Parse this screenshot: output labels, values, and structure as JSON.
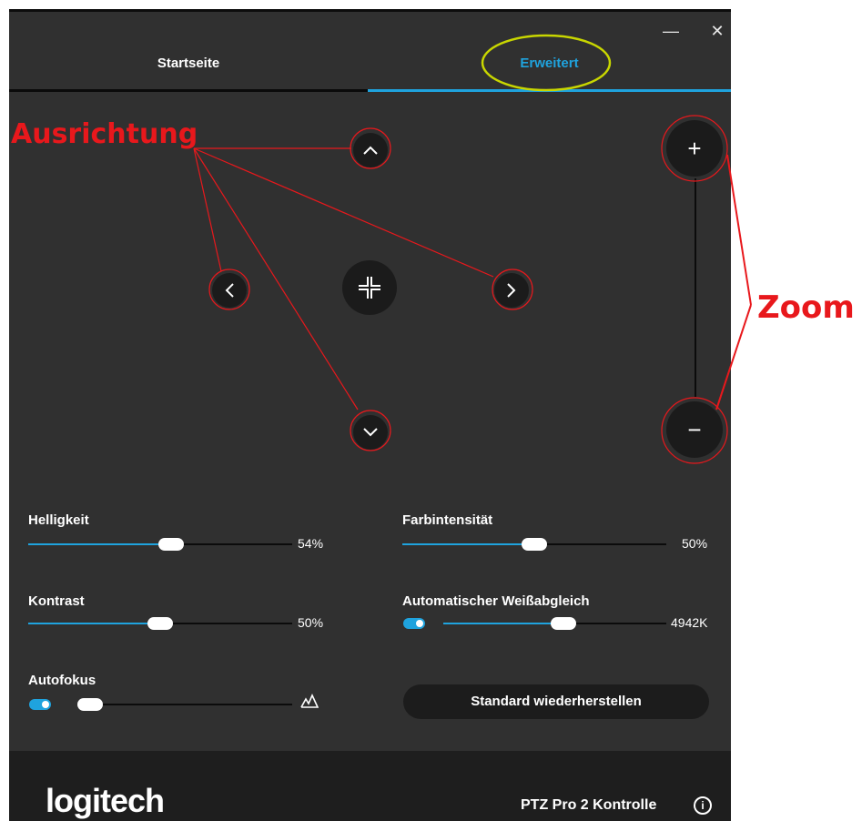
{
  "window": {
    "minimize_icon": "minus-icon",
    "close_icon": "close-icon",
    "minimize_glyph": "—",
    "close_glyph": "✕"
  },
  "tabs": [
    {
      "label": "Startseite",
      "active": false
    },
    {
      "label": "Erweitert",
      "active": true
    }
  ],
  "pan_tilt": {
    "up_icon": "chevron-up-icon",
    "down_icon": "chevron-down-icon",
    "left_icon": "chevron-left-icon",
    "right_icon": "chevron-right-icon",
    "center_icon": "center-crosshair-icon"
  },
  "zoom": {
    "in_glyph": "+",
    "out_glyph": "−"
  },
  "sliders": {
    "brightness": {
      "label": "Helligkeit",
      "value": "54%",
      "level": 0.54
    },
    "saturation": {
      "label": "Farbintensität",
      "value": "50%",
      "level": 0.5
    },
    "contrast": {
      "label": "Kontrast",
      "value": "50%",
      "level": 0.5
    },
    "white_balance": {
      "label": "Automatischer Weißabgleich",
      "value": "4942K",
      "level": 0.54,
      "auto_enabled": true
    },
    "focus": {
      "label": "Autofokus",
      "level": 0.0,
      "auto_enabled": true,
      "end_icon": "focus-mountain-icon"
    }
  },
  "restore_button": {
    "label": "Standard wiederherstellen"
  },
  "footer": {
    "logo_text": "logitech",
    "product_name": "PTZ Pro 2 Kontrolle",
    "info_glyph": "i"
  },
  "annotations": {
    "pan_label": "Ausrichtung",
    "zoom_label": "Zoom",
    "color": "#e8181c",
    "highlight_color": "#c8d600"
  },
  "colors": {
    "accent": "#1fa3de",
    "background": "#303030",
    "footer": "#1e1e1e"
  }
}
